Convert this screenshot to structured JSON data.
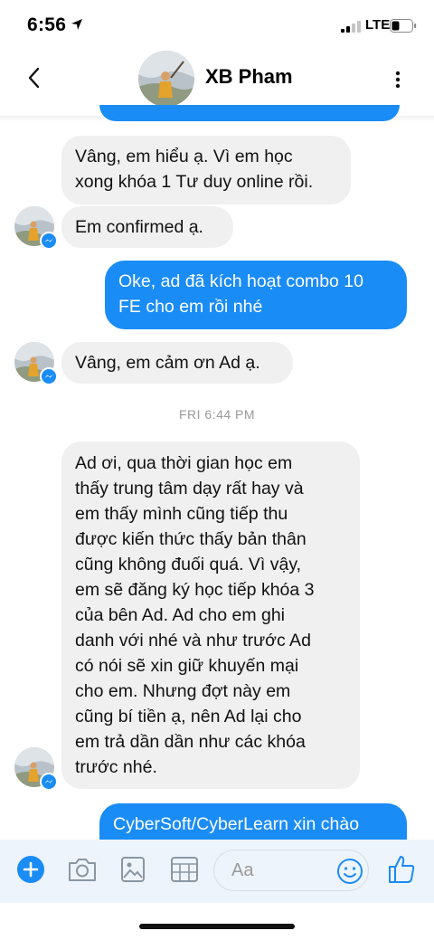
{
  "status_bar": {
    "time": "6:56",
    "network": "LTE",
    "icons": [
      "location-arrow-icon",
      "signal-bars-icon",
      "battery-icon"
    ]
  },
  "header": {
    "contact_name": "XB Pham",
    "icons": [
      "back-chevron-icon",
      "more-options-icon"
    ]
  },
  "messages": [
    {
      "direction": "incoming",
      "text": "Vâng, em hiểu ạ. Vì em học\nxong khóa 1 Tư duy online rồi."
    },
    {
      "direction": "incoming",
      "text": "Em confirmed ạ."
    },
    {
      "direction": "outgoing",
      "text": "Oke, ad đã kích hoạt combo 10\nFE cho em rồi nhé"
    },
    {
      "direction": "incoming",
      "text": "Vâng, em cảm ơn Ad ạ."
    },
    {
      "direction": "incoming",
      "text": "Ad ơi, qua thời gian học em\nthấy trung tâm dạy rất hay và\nem thấy mình cũng tiếp thu\nđược kiến thức thấy bản thân\ncũng không đuối quá. Vì vậy,\nem sẽ đăng ký học tiếp khóa 3\ncủa bên Ad. Ad cho em ghi\ndanh với nhé và như trước Ad\ncó nói sẽ xin giữ khuyến mại\ncho em. Nhưng đợt này em\ncũng bí tiền ạ, nên Ad lại cho\nem trả dần dần như các khóa\ntrước nhé."
    },
    {
      "direction": "outgoing",
      "text": "CyberSoft/CyberLearn xin chào"
    }
  ],
  "timestamp": "FRI 6:44 PM",
  "composer": {
    "placeholder": "Aa",
    "icons": [
      "plus-icon",
      "camera-icon",
      "photo-icon",
      "gif-sticker-icon",
      "emoji-icon",
      "like-icon"
    ]
  },
  "colors": {
    "accent": "#1a8cf5",
    "incoming_bubble": "#f1f0f0",
    "composer_bg": "#eef4fb"
  }
}
